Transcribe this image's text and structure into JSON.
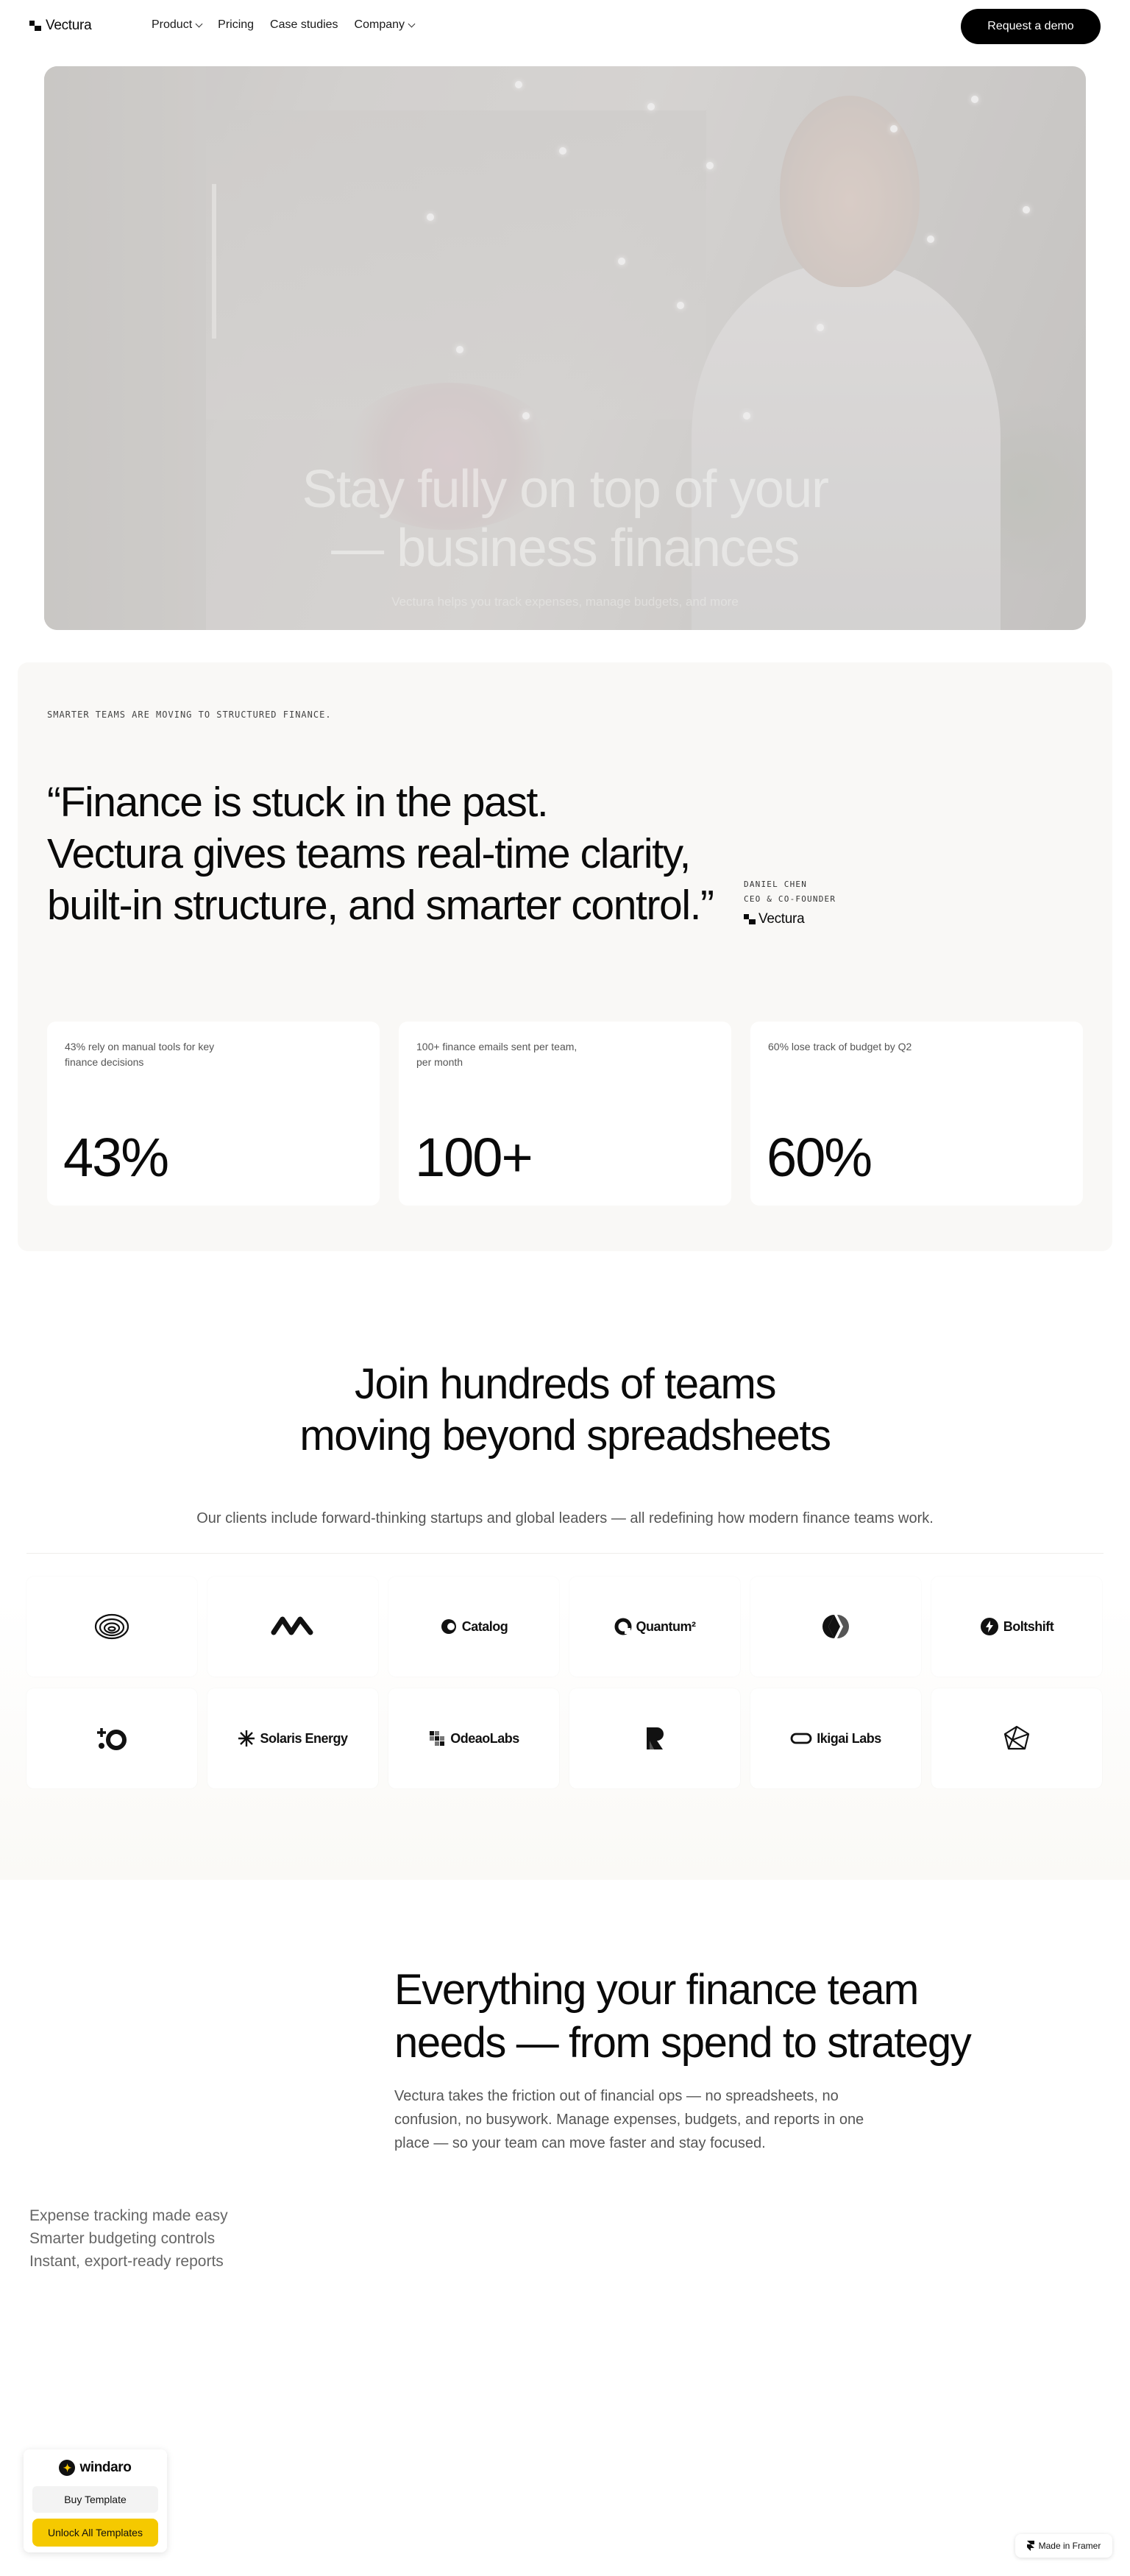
{
  "nav": {
    "logo": "Vectura",
    "links": [
      "Product",
      "Pricing",
      "Case studies",
      "Company"
    ],
    "cta": "Request a demo"
  },
  "hero": {
    "title": "Stay fully on top of your\n— business finances",
    "subtitle": "Vectura helps you track expenses, manage budgets, and more"
  },
  "quote_section": {
    "eyebrow": "SMARTER TEAMS ARE MOVING TO STRUCTURED FINANCE.",
    "quote": "“Finance is stuck in the past.\nVectura gives teams real-time clarity,\nbuilt-in structure, and smarter control.”",
    "author_name": "DANIEL CHEN",
    "author_role": "CEO & CO-FOUNDER",
    "author_company": "Vectura",
    "stats": [
      {
        "label": "43% rely on manual tools for key finance decisions",
        "value": "43%"
      },
      {
        "label": "100+ finance emails sent per team, per month",
        "value": "100+"
      },
      {
        "label": "60% lose track of budget by Q2",
        "value": "60%"
      }
    ]
  },
  "clients": {
    "title": "Join hundreds of teams\nmoving beyond spreadsheets",
    "subtitle": "Our clients include forward-thinking startups and global leaders — all redefining how modern finance teams work.",
    "logos": [
      {
        "icon": "rings-icon",
        "name": ""
      },
      {
        "icon": "infinity-icon",
        "name": ""
      },
      {
        "icon": "catalog-icon",
        "name": "Catalog"
      },
      {
        "icon": "quantum-icon",
        "name": "Quantum²"
      },
      {
        "icon": "split-circle-icon",
        "name": ""
      },
      {
        "icon": "bolt-icon",
        "name": "Boltshift"
      },
      {
        "icon": "plus-circle-icon",
        "name": ""
      },
      {
        "icon": "sunburst-icon",
        "name": "Solaris Energy"
      },
      {
        "icon": "grid-icon",
        "name": "OdeaoLabs"
      },
      {
        "icon": "r-shape-icon",
        "name": ""
      },
      {
        "icon": "pill-icon",
        "name": "Ikigai Labs"
      },
      {
        "icon": "polyhedron-icon",
        "name": ""
      }
    ]
  },
  "features": {
    "title": "Everything your finance team\nneeds — from spend to strategy",
    "body": "Vectura takes the friction out of financial ops — no spreadsheets, no confusion, no busywork. Manage expenses, budgets, and reports in one place — so your team can move faster and stay focused.",
    "list": [
      "Expense tracking made easy",
      "Smarter budgeting controls",
      "Instant, export-ready reports"
    ]
  },
  "badges": {
    "windaro_brand": "windaro",
    "buy_label": "Buy Template",
    "unlock_label": "Unlock All Templates",
    "framer_label": "Made in Framer"
  }
}
